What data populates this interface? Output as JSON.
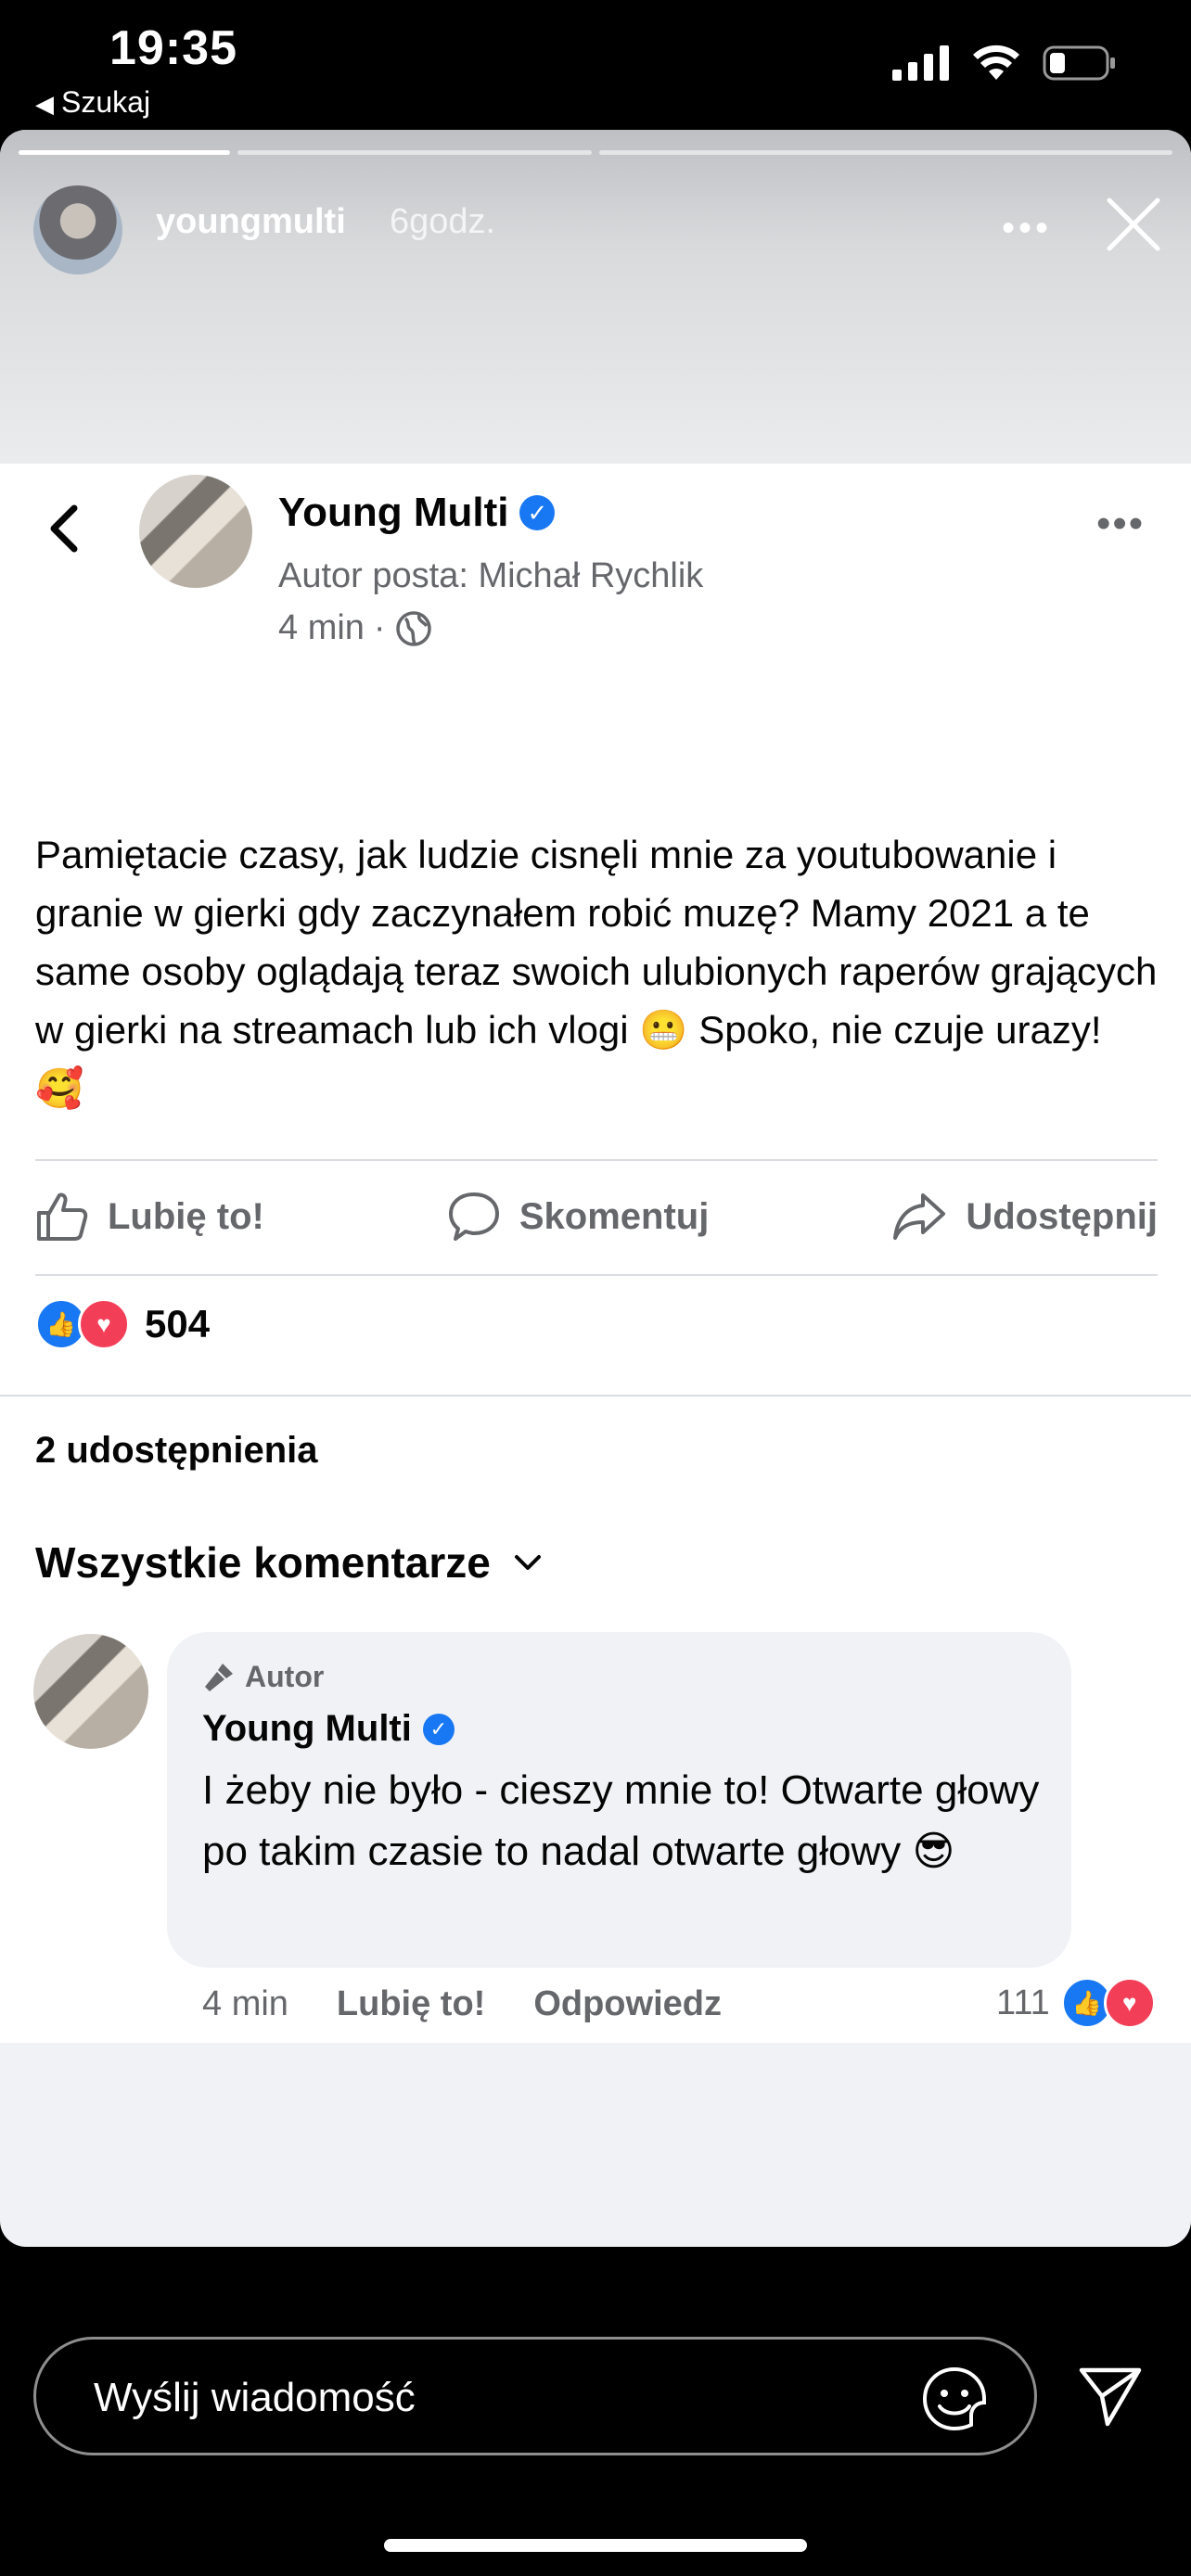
{
  "status_bar": {
    "time": "19:35",
    "back_app": "Szukaj",
    "battery_percent": 25
  },
  "story": {
    "username": "youngmulti",
    "time_ago": "6godz.",
    "segments": 3,
    "active_segment": 1
  },
  "post": {
    "author": "Young Multi",
    "posted_by": "Autor posta: Michał Rychlik",
    "time": "4 min",
    "separator": "·",
    "text": "Pamiętacie czasy, jak ludzie cisnęli mnie za youtubowanie i granie w gierki gdy zaczynałem robić muzę? Mamy 2021 a te same osoby oglądają teraz swoich ulubionych raperów grających w gierki na streamach lub ich vlogi 😬 Spoko, nie czuje urazy! 🥰",
    "actions": {
      "like": "Lubię to!",
      "comment": "Skomentuj",
      "share": "Udostępnij"
    },
    "reaction_count": "504",
    "shares": "2 udostępnienia",
    "comments_filter": "Wszystkie komentarze"
  },
  "comment": {
    "badge": "Autor",
    "author": "Young Multi",
    "text": "I żeby nie było - cieszy mnie to! Otwarte głowy po takim czasie to nadal otwarte głowy 😎",
    "time": "4 min",
    "like": "Lubię to!",
    "reply": "Odpowiedz",
    "reaction_count": "111"
  },
  "message_bar": {
    "placeholder": "Wyślij wiadomość"
  },
  "colors": {
    "fb_blue": "#1877f2",
    "love_red": "#f33e58",
    "meta_gray": "#65676b"
  }
}
